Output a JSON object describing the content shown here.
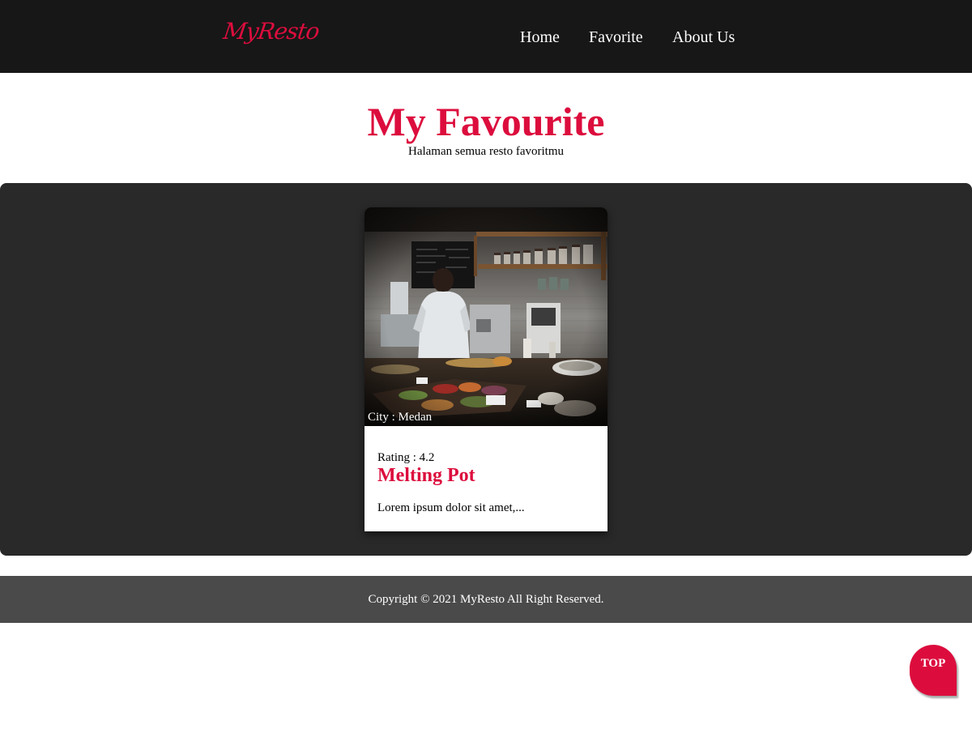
{
  "header": {
    "logo": "MyResto",
    "nav": {
      "home": "Home",
      "favorite": "Favorite",
      "about": "About Us"
    }
  },
  "hero": {
    "title": "My Favourite",
    "subtitle": "Halaman semua resto favoritmu"
  },
  "restaurants": [
    {
      "city": "City : Medan",
      "rating": "Rating : 4.2",
      "name": "Melting Pot",
      "description": "Lorem ipsum dolor sit amet,..."
    }
  ],
  "footer": {
    "copyright": "Copyright © 2021 MyResto All Right Reserved."
  },
  "top_button": {
    "label": "TOP"
  },
  "colors": {
    "accent": "#dc0d3d",
    "header_bg": "#171717",
    "content_bg": "#292929",
    "footer_bg": "#4a4a4a"
  }
}
